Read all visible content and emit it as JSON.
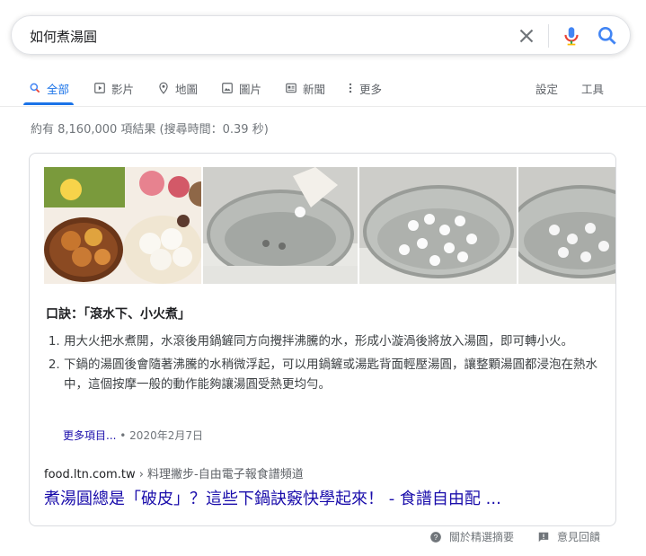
{
  "search": {
    "query": "如何煮湯圓"
  },
  "tabs": [
    {
      "label": "全部",
      "icon": "search-icon",
      "active": true
    },
    {
      "label": "影片",
      "icon": "video-icon"
    },
    {
      "label": "地圖",
      "icon": "map-pin-icon"
    },
    {
      "label": "圖片",
      "icon": "image-icon"
    },
    {
      "label": "新聞",
      "icon": "news-icon"
    },
    {
      "label": "更多",
      "icon": "more-vert-icon"
    }
  ],
  "tools": {
    "settings": "設定",
    "tools": "工具"
  },
  "stats": "約有 8,160,000 項結果 (搜尋時間：0.39 秒)",
  "snippet": {
    "title": "口訣：「滾水下、小火煮」",
    "steps": [
      "用大火把水煮開，水滾後用鍋鏟同方向攪拌沸騰的水，形成小漩渦後將放入湯圓，即可轉小火。",
      "下鍋的湯圓後會隨著沸騰的水稍微浮起，可以用鍋鏟或湯匙背面輕壓湯圓，讓整顆湯圓都浸泡在熱水中，這個按摩一般的動作能夠讓湯圓受熱更均勻。"
    ],
    "more_link": "更多項目...",
    "date": "• 2020年2月7日"
  },
  "source": {
    "domain": "food.ltn.com.tw",
    "breadcrumb": "› 料理撇步-自由電子報食譜頻道"
  },
  "result": {
    "title": "煮湯圓總是「破皮」？這些下鍋訣竅快學起來！ - 食譜自由配 ..."
  },
  "footer": {
    "about": "關於精選摘要",
    "feedback": "意見回饋"
  },
  "colors": {
    "link": "#1a0dab",
    "accent": "#1a73e8",
    "muted": "#70757a"
  }
}
